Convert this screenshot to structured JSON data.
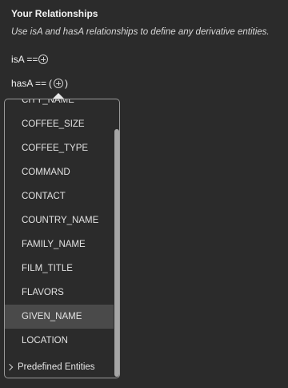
{
  "section": {
    "title": "Your Relationships",
    "description": "Use isA and hasA relationships to define any derivative entities."
  },
  "relationships": {
    "isa_label": "isA ==",
    "hasa_label": "hasA ==",
    "open_paren": "(",
    "close_paren": ")"
  },
  "dropdown": {
    "items": [
      "CITY_NAME",
      "COFFEE_SIZE",
      "COFFEE_TYPE",
      "COMMAND",
      "CONTACT",
      "COUNTRY_NAME",
      "FAMILY_NAME",
      "FILM_TITLE",
      "FLAVORS",
      "GIVEN_NAME",
      "LOCATION"
    ],
    "selected": "GIVEN_NAME",
    "group_label": "Predefined Entities"
  },
  "icons": {
    "add": "plus-circle-icon",
    "expand": "chevron-right-icon"
  }
}
